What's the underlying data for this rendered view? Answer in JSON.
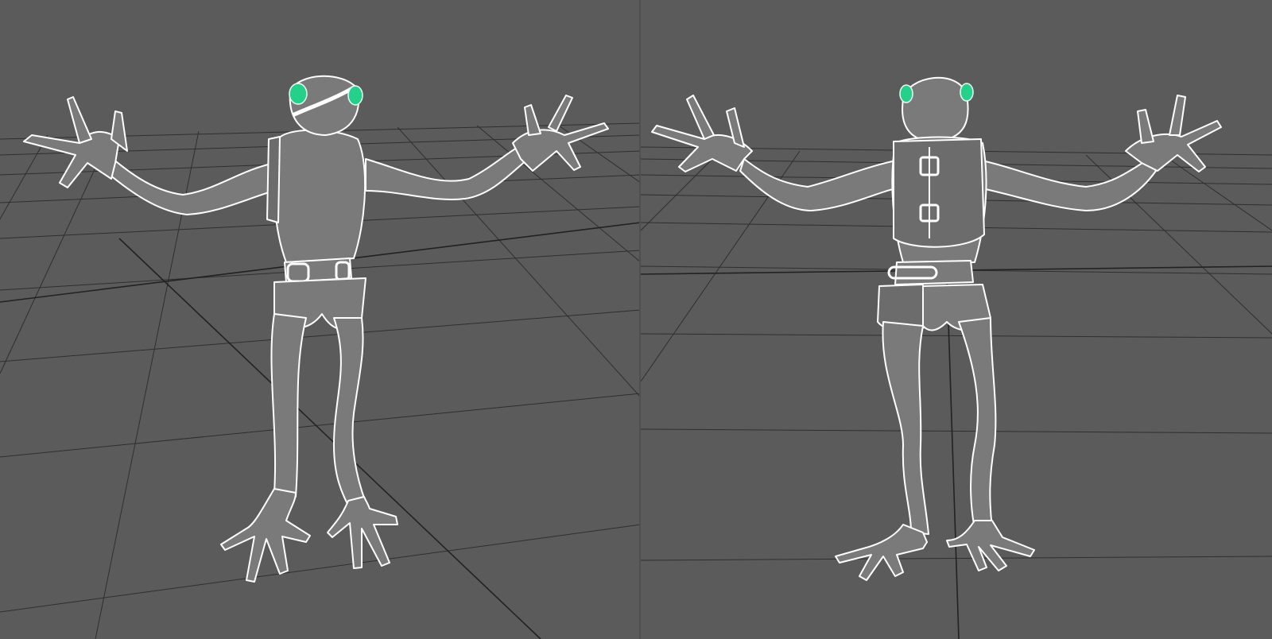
{
  "scene": {
    "background_color": "#5b5b5b",
    "grid_color": "#2f2f2f",
    "wireframe_color": "#ffffff",
    "eye_color": "#25d08a"
  },
  "viewports": [
    {
      "view": "perspective-front",
      "subject": "frog-character-wireframe"
    },
    {
      "view": "perspective-back",
      "subject": "frog-character-wireframe"
    }
  ]
}
